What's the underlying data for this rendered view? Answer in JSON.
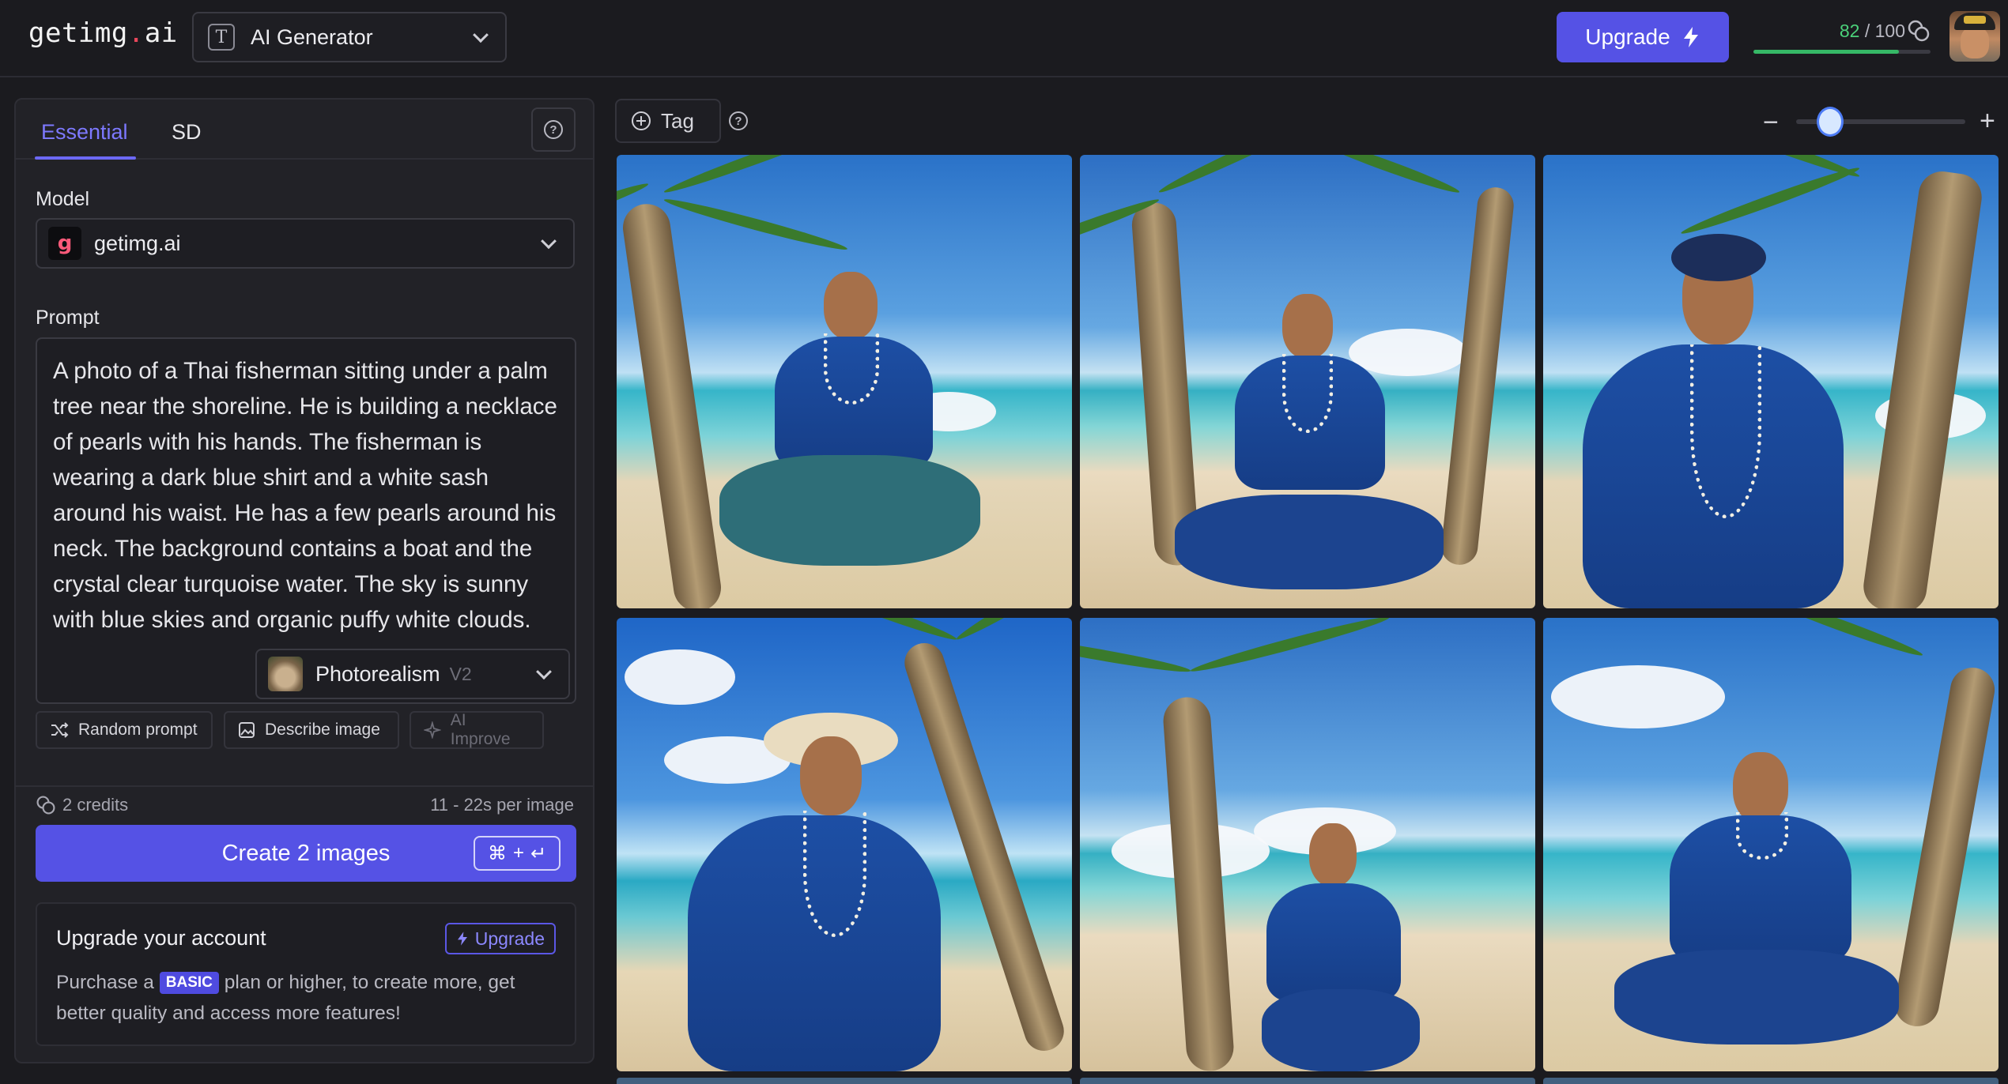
{
  "header": {
    "logo_main": "getimg",
    "logo_dot": ".",
    "logo_tld": "ai",
    "generator_select": {
      "icon": "text-t-icon",
      "label": "AI Generator"
    },
    "upgrade_button": "Upgrade",
    "credits": {
      "used": "82",
      "total": "/ 100",
      "fraction_used": 0.82
    }
  },
  "left_panel": {
    "tabs": [
      {
        "label": "Essential",
        "active": true
      },
      {
        "label": "SD",
        "active": false
      }
    ],
    "model_label": "Model",
    "model_value": "getimg.ai",
    "prompt_label": "Prompt",
    "prompt_text": "A photo of a Thai fisherman sitting under a palm tree near the shoreline. He is building a necklace of pearls with his hands. The fisherman is wearing a dark blue shirt and a white sash around his waist. He has a few pearls around his neck. The background contains a boat and the crystal clear turquoise water. The sky is sunny with blue skies and organic puffy white clouds.",
    "style_select": {
      "name": "Photorealism",
      "version": "V2"
    },
    "actions": {
      "random": "Random prompt",
      "describe": "Describe image",
      "improve": "AI Improve"
    },
    "cost_credits": "2 credits",
    "time_per_image": "11 - 22s per image",
    "create_button": "Create 2 images",
    "shortcut_plus": "+",
    "upgrade_card": {
      "title": "Upgrade your account",
      "button": "Upgrade",
      "desc_before": "Purchase a",
      "badge": "BASIC",
      "desc_after": "plan or higher, to create more, get better quality and access more features!"
    }
  },
  "gallery": {
    "tag_button": "Tag",
    "zoom_level": 0.2,
    "images": [
      {
        "name": "fisherman-1"
      },
      {
        "name": "fisherman-2"
      },
      {
        "name": "fisherman-3"
      },
      {
        "name": "fisherman-4"
      },
      {
        "name": "fisherman-5"
      },
      {
        "name": "fisherman-6"
      }
    ]
  },
  "colors": {
    "accent": "#5552e5",
    "tab_active": "#7d79ff",
    "credits_green": "#4bd17a"
  }
}
